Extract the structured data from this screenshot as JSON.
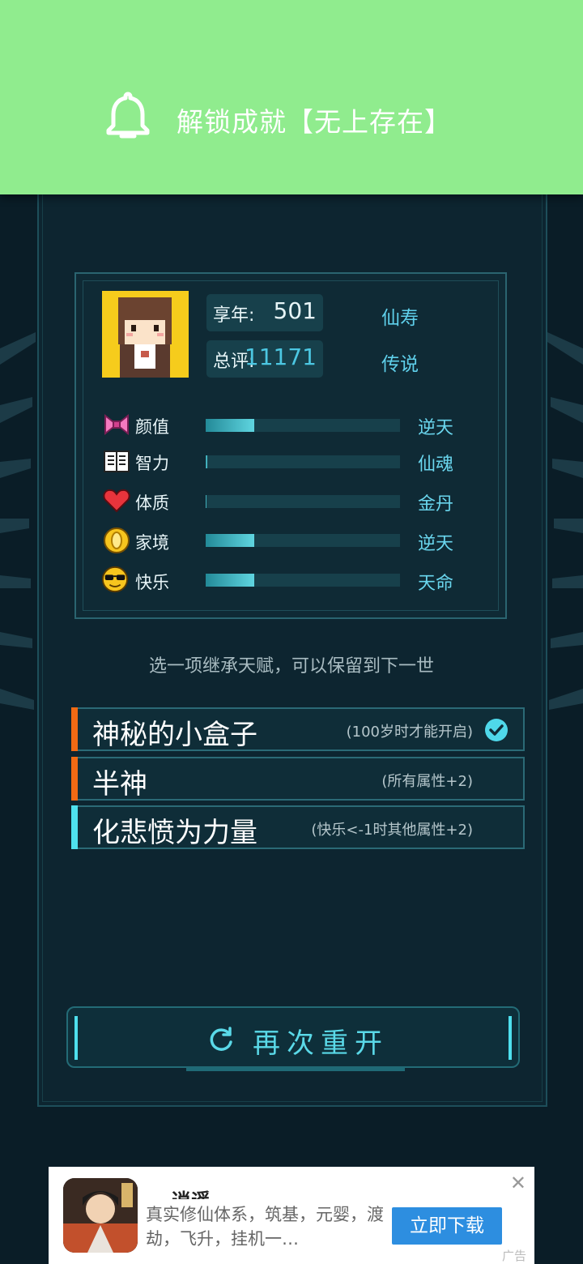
{
  "notification": {
    "text": "解锁成就【无上存在】",
    "icon": "bell-icon"
  },
  "summary": {
    "age_label": "享年:",
    "age_value": "501",
    "age_grade": "仙寿",
    "score_label": "总评:",
    "score_value": "11171",
    "score_grade": "传说"
  },
  "stats": [
    {
      "icon": "bow-icon",
      "name": "颜值",
      "grade": "逆天",
      "level": 0.25
    },
    {
      "icon": "book-icon",
      "name": "智力",
      "grade": "仙魂",
      "level": 0.01
    },
    {
      "icon": "heart-icon",
      "name": "体质",
      "grade": "金丹",
      "level": 0.005
    },
    {
      "icon": "coin-icon",
      "name": "家境",
      "grade": "逆天",
      "level": 0.25
    },
    {
      "icon": "sunglasses-face-icon",
      "name": "快乐",
      "grade": "天命",
      "level": 0.25
    }
  ],
  "hint": "选一项继承天赋，可以保留到下一世",
  "talents": [
    {
      "name": "神秘的小盒子",
      "desc": "(100岁时才能开启)",
      "color": "#f06a14",
      "selected": true
    },
    {
      "name": "半神",
      "desc": "(所有属性+2)",
      "color": "#f06a14",
      "selected": false
    },
    {
      "name": "化悲愤为力量",
      "desc": "(快乐<-1时其他属性+2)",
      "color": "#4fe1ee",
      "selected": false
    }
  ],
  "restart_label": "再次重开",
  "ad": {
    "title": "逍遥",
    "description": "真实修仙体系，筑基，元婴，渡劫，飞升，挂机一…",
    "button": "立即下载",
    "close": "✕",
    "tag": "广告"
  },
  "colors": {
    "accent": "#5ad9e8",
    "notify_bg": "#90ec8e",
    "panel_bg": "#0d2530"
  }
}
